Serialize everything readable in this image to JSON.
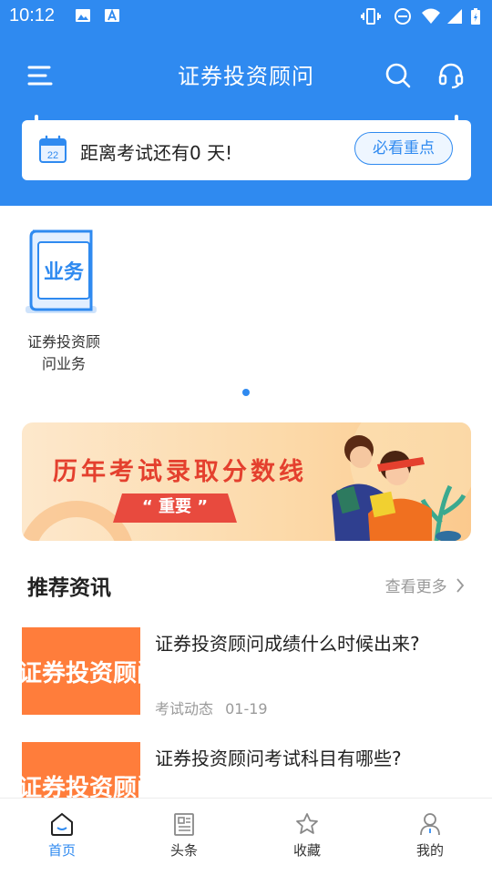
{
  "status_bar": {
    "time": "10:12"
  },
  "app_bar": {
    "title": "证券投资顾问"
  },
  "notice": {
    "text": "距离考试还有0 天!",
    "calendar_day": "22",
    "button_label": "必看重点"
  },
  "categories": [
    {
      "icon_text": "业务",
      "label_line1": "证券投资顾",
      "label_line2": "问业务"
    }
  ],
  "banner": {
    "title": "历年考试录取分数线",
    "tag": "“ 重要 ”"
  },
  "recommended": {
    "section_title": "推荐资讯",
    "more_label": "查看更多",
    "items": [
      {
        "thumb_text": "证券投资顾问",
        "title": "证券投资顾问成绩什么时候出来?",
        "category": "考试动态",
        "date": "01-19"
      },
      {
        "thumb_text": "证券投资顾问",
        "title": "证券投资顾问考试科目有哪些?"
      }
    ]
  },
  "tabs": [
    {
      "label": "首页",
      "active": true
    },
    {
      "label": "头条"
    },
    {
      "label": "收藏"
    },
    {
      "label": "我的"
    }
  ],
  "colors": {
    "primary": "#2f8af0",
    "accent_orange": "#ff7d3b",
    "banner_red": "#e4402e"
  }
}
